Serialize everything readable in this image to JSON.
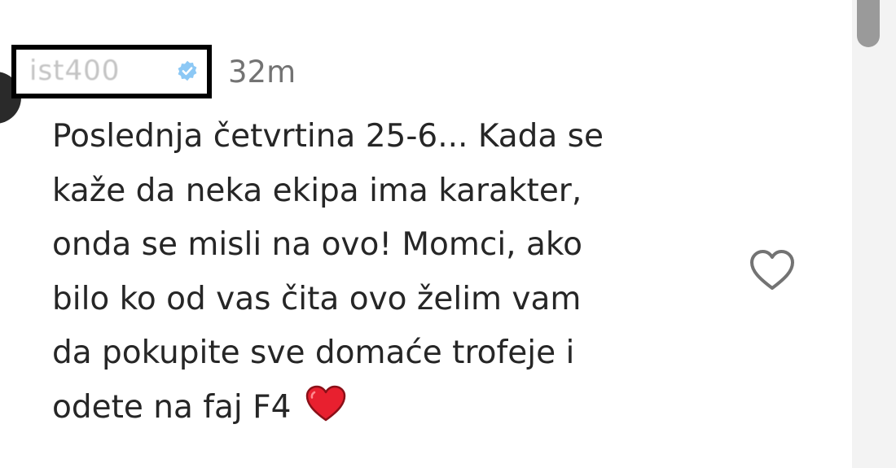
{
  "comment": {
    "username": "ist400",
    "verified_icon": "verified-badge-icon",
    "timestamp": "32m",
    "text_lines": [
      "Poslednja četvrtina 25-6... Kada se",
      "kaže da neka ekipa ima karakter,",
      "onda se misli na ovo! Momci, ako",
      "bilo ko od vas čita ovo želim vam",
      "da pokupite sve domaće trofeje i",
      "odete na faj F4"
    ],
    "emoji": "red-heart-emoji",
    "like_icon": "heart-outline-icon"
  },
  "colors": {
    "text": "#262626",
    "timestamp": "#737373",
    "redaction_border": "#000000",
    "heart_emoji": "#e8202f",
    "like_icon": "#737373",
    "scrollbar_thumb": "#9a9a9a",
    "scrollbar_track": "#f3f3f3"
  }
}
